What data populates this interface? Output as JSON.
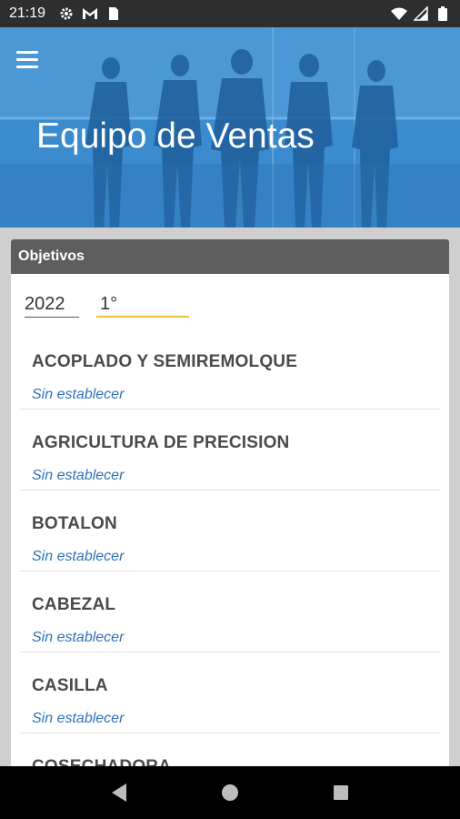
{
  "status_bar": {
    "time": "21:19",
    "left_icons": [
      "gear-icon",
      "gmail-icon",
      "sim-icon"
    ],
    "right_icons": [
      "wifi-icon",
      "signal-icon",
      "battery-icon"
    ]
  },
  "header": {
    "title": "Equipo de Ventas",
    "accent_color": "#2f7fc4"
  },
  "card": {
    "title": "Objetivos",
    "year": "2022",
    "period": "1°",
    "items": [
      {
        "name": "ACOPLADO Y SEMIREMOLQUE",
        "status": "Sin establecer"
      },
      {
        "name": "AGRICULTURA DE PRECISION",
        "status": "Sin establecer"
      },
      {
        "name": "BOTALON",
        "status": "Sin establecer"
      },
      {
        "name": "CABEZAL",
        "status": "Sin establecer"
      },
      {
        "name": "CASILLA",
        "status": "Sin establecer"
      },
      {
        "name": "COSECHADORA",
        "status": ""
      }
    ]
  },
  "nav_bar": {
    "buttons": [
      "back-icon",
      "home-icon",
      "recents-icon"
    ]
  }
}
